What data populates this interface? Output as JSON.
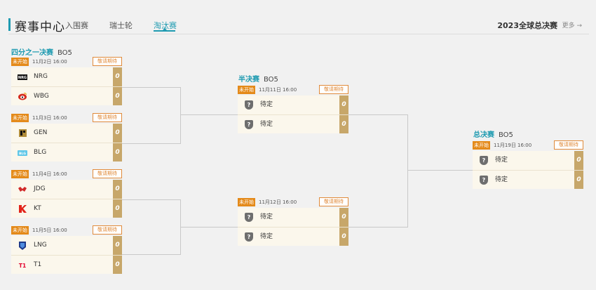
{
  "header": {
    "title": "赛事中心",
    "tabs": [
      {
        "label": "入围赛",
        "active": false
      },
      {
        "label": "瑞士轮",
        "active": false
      },
      {
        "label": "淘汰赛",
        "active": true
      }
    ],
    "season": "2023全球总决赛",
    "more": "更多 →"
  },
  "stages": {
    "quarter": {
      "name": "四分之一决赛",
      "bo": "BO5"
    },
    "semi": {
      "name": "半决赛",
      "bo": "BO5"
    },
    "final": {
      "name": "总决赛",
      "bo": "BO5"
    }
  },
  "matches": [
    {
      "status": "未开始",
      "date": "11月2日 16:00",
      "cta": "敬请期待",
      "teams": [
        {
          "name": "NRG",
          "icon": "nrg-logo",
          "score": "0"
        },
        {
          "name": "WBG",
          "icon": "wbg-logo",
          "score": "0"
        }
      ]
    },
    {
      "status": "未开始",
      "date": "11月3日 16:00",
      "cta": "敬请期待",
      "teams": [
        {
          "name": "GEN",
          "icon": "gen-logo",
          "score": "0"
        },
        {
          "name": "BLG",
          "icon": "blg-logo",
          "score": "0"
        }
      ]
    },
    {
      "status": "未开始",
      "date": "11月4日 16:00",
      "cta": "敬请期待",
      "teams": [
        {
          "name": "JDG",
          "icon": "jdg-logo",
          "score": "0"
        },
        {
          "name": "KT",
          "icon": "kt-logo",
          "score": "0"
        }
      ]
    },
    {
      "status": "未开始",
      "date": "11月5日 16:00",
      "cta": "敬请期待",
      "teams": [
        {
          "name": "LNG",
          "icon": "lng-logo",
          "score": "0"
        },
        {
          "name": "T1",
          "icon": "t1-logo",
          "score": "0"
        }
      ]
    },
    {
      "status": "未开始",
      "date": "11月11日 16:00",
      "cta": "敬请期待",
      "teams": [
        {
          "name": "待定",
          "icon": "tbd-shield-icon",
          "score": "0"
        },
        {
          "name": "待定",
          "icon": "tbd-shield-icon",
          "score": "0"
        }
      ]
    },
    {
      "status": "未开始",
      "date": "11月12日 16:00",
      "cta": "敬请期待",
      "teams": [
        {
          "name": "待定",
          "icon": "tbd-shield-icon",
          "score": "0"
        },
        {
          "name": "待定",
          "icon": "tbd-shield-icon",
          "score": "0"
        }
      ]
    },
    {
      "status": "未开始",
      "date": "11月19日 16:00",
      "cta": "敬请期待",
      "teams": [
        {
          "name": "待定",
          "icon": "tbd-shield-icon",
          "score": "0"
        },
        {
          "name": "待定",
          "icon": "tbd-shield-icon",
          "score": "0"
        }
      ]
    }
  ],
  "colors": {
    "accent": "#1f9bb1",
    "status": "#e48a1a",
    "score": "#c7a76a",
    "card": "#fbf7ec"
  }
}
